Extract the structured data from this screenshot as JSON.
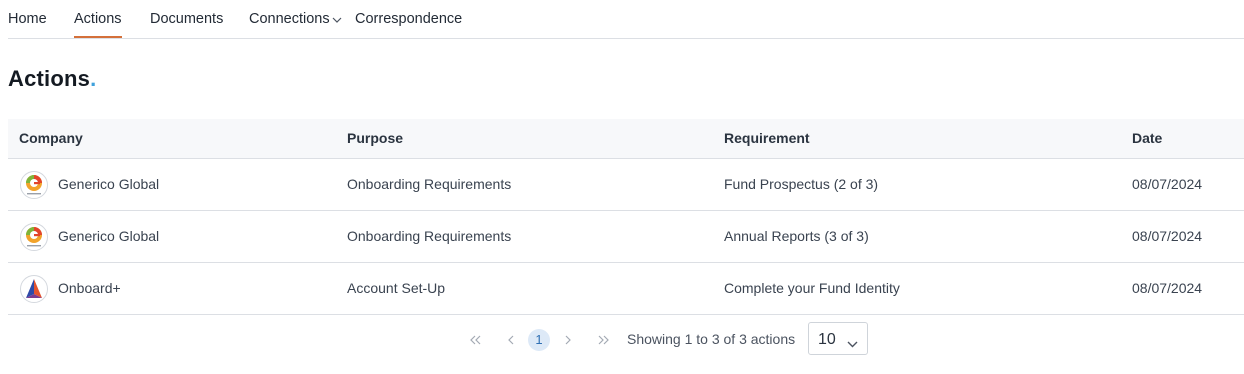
{
  "nav": {
    "items": [
      {
        "label": "Home"
      },
      {
        "label": "Actions"
      },
      {
        "label": "Documents"
      },
      {
        "label": "Connections"
      },
      {
        "label": "Correspondence"
      }
    ],
    "active": "Actions",
    "accent_color": "#d4703a"
  },
  "page": {
    "title": "Actions",
    "title_dot": ".",
    "dot_color": "#3fa1dc"
  },
  "table": {
    "columns": [
      "Company",
      "Purpose",
      "Requirement",
      "Date"
    ],
    "rows": [
      {
        "logo": "generico-global-logo",
        "company": "Generico Global",
        "purpose": "Onboarding Requirements",
        "requirement": "Fund Prospectus (2 of 3)",
        "date": "08/07/2024"
      },
      {
        "logo": "generico-global-logo",
        "company": "Generico Global",
        "purpose": "Onboarding Requirements",
        "requirement": "Annual Reports (3 of 3)",
        "date": "08/07/2024"
      },
      {
        "logo": "onboard-plus-logo",
        "company": "Onboard+",
        "purpose": "Account Set-Up",
        "requirement": "Complete your Fund Identity",
        "date": "08/07/2024"
      }
    ]
  },
  "pagination": {
    "first_icon": "double-chevron-left-icon",
    "prev_icon": "chevron-left-icon",
    "next_icon": "chevron-right-icon",
    "last_icon": "double-chevron-right-icon",
    "current_page": "1",
    "info": "Showing 1 to 3 of 3 actions",
    "page_size": "10"
  }
}
